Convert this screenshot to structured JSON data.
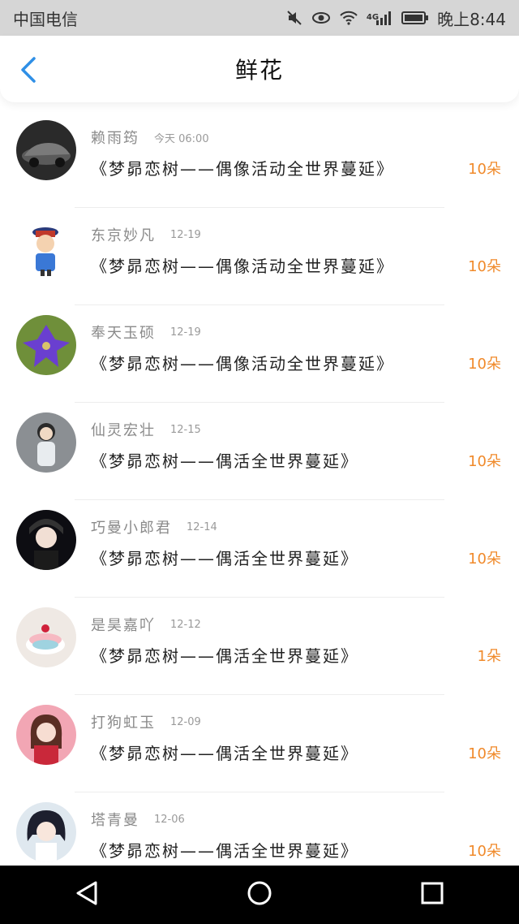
{
  "status_bar": {
    "carrier": "中国电信",
    "network": "4G",
    "time": "晚上8:44",
    "icons": [
      "mute-icon",
      "eye-icon",
      "wifi-icon",
      "signal-icon",
      "battery-icon"
    ]
  },
  "header": {
    "back_icon": "chevron-left-icon",
    "title": "鲜花"
  },
  "colors": {
    "accent": "#2f8fe6",
    "count": "#f08a2b",
    "name": "#8a8a8a",
    "status_bar_bg": "#d6d6d6"
  },
  "list": {
    "items": [
      {
        "name": "赖雨筠",
        "time": "今天 06:00",
        "desc": "《梦昴恋树——偶像活动全世界蔓延》",
        "count": "10朵",
        "avatar": "car-photo"
      },
      {
        "name": "东京妙凡",
        "time": "12-19",
        "desc": "《梦昴恋树——偶像活动全世界蔓延》",
        "count": "10朵",
        "avatar": "cartoon-official"
      },
      {
        "name": "奉天玉硕",
        "time": "12-19",
        "desc": "《梦昴恋树——偶像活动全世界蔓延》",
        "count": "10朵",
        "avatar": "purple-flower"
      },
      {
        "name": "仙灵宏壮",
        "time": "12-15",
        "desc": "《梦昴恋树——偶活全世界蔓延》",
        "count": "10朵",
        "avatar": "girl-photo"
      },
      {
        "name": "巧曼小郎君",
        "time": "12-14",
        "desc": "《梦昴恋树——偶活全世界蔓延》",
        "count": "10朵",
        "avatar": "boy-selfie"
      },
      {
        "name": "是昊嘉吖",
        "time": "12-12",
        "desc": "《梦昴恋树——偶活全世界蔓延》",
        "count": "1朵",
        "avatar": "dessert"
      },
      {
        "name": "打狗虹玉",
        "time": "12-09",
        "desc": "《梦昴恋树——偶活全世界蔓延》",
        "count": "10朵",
        "avatar": "illustrated-girl"
      },
      {
        "name": "塔青曼",
        "time": "12-06",
        "desc": "《梦昴恋树——偶活全世界蔓延》",
        "count": "10朵",
        "avatar": "anime-girl"
      }
    ]
  },
  "nav_bar": {
    "buttons": [
      "back-triangle-icon",
      "home-circle-icon",
      "recents-square-icon"
    ]
  }
}
